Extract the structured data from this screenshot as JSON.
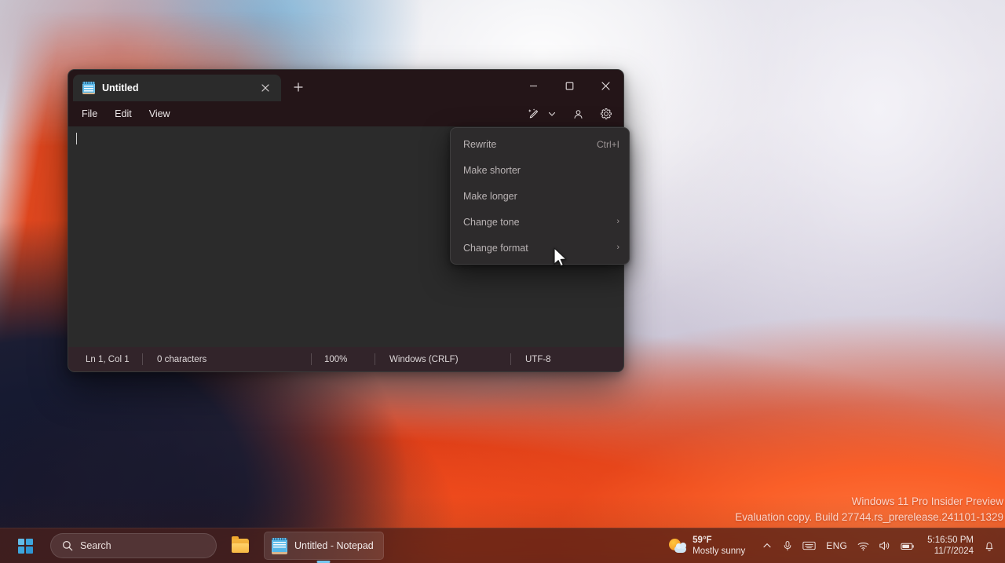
{
  "desktop": {
    "watermark_line1": "Windows 11 Pro Insider Preview",
    "watermark_line2": "Evaluation copy. Build 27744.rs_prerelease.241101-1329"
  },
  "notepad": {
    "tab": {
      "title": "Untitled",
      "close_label": "✕",
      "icon": "notepad-icon"
    },
    "new_tab_label": "＋",
    "window_controls": {
      "minimize": "—",
      "maximize": "□",
      "close": "✕"
    },
    "menubar": {
      "items": [
        {
          "label": "File"
        },
        {
          "label": "Edit"
        },
        {
          "label": "View"
        }
      ],
      "ai_button": "copilot-rewrite-icon",
      "ai_chevron": "chevron-down-icon",
      "account_button": "account-icon",
      "settings_button": "gear-icon"
    },
    "editor": {
      "content": ""
    },
    "statusbar": {
      "position": "Ln 1, Col 1",
      "characters": "0 characters",
      "zoom": "100%",
      "line_ending": "Windows (CRLF)",
      "encoding": "UTF-8"
    }
  },
  "ai_menu": {
    "items": [
      {
        "label": "Rewrite",
        "accel": "Ctrl+I",
        "submenu": false
      },
      {
        "label": "Make shorter",
        "accel": "",
        "submenu": false
      },
      {
        "label": "Make longer",
        "accel": "",
        "submenu": false
      },
      {
        "label": "Change tone",
        "accel": "",
        "submenu": true
      },
      {
        "label": "Change format",
        "accel": "",
        "submenu": true
      }
    ],
    "submenu_chevron": "›"
  },
  "taskbar": {
    "start_label": "Start",
    "search": {
      "placeholder": "Search",
      "value": "Search",
      "icon": "search-icon"
    },
    "apps": [
      {
        "name": "file-explorer",
        "label": "File Explorer"
      },
      {
        "name": "notepad",
        "label": "Untitled - Notepad"
      }
    ],
    "tray": {
      "weather": {
        "temperature": "59°F",
        "condition": "Mostly sunny",
        "icon": "sun-cloud-icon"
      },
      "overflow": "chevron-up-icon",
      "microphone": "microphone-icon",
      "touch_keyboard": "keyboard-icon",
      "language": "ENG",
      "network": "wifi-icon",
      "volume": "speaker-icon",
      "battery": "battery-icon",
      "time": "5:16:50 PM",
      "date": "11/7/2024",
      "notifications": "bell-icon"
    }
  },
  "colors": {
    "accent": "#74c7f0",
    "window_chrome": "#241518",
    "editor_bg": "#2b2b2b",
    "menu_bg": "#2d2b2c",
    "statusbar_bg": "#32242a"
  }
}
